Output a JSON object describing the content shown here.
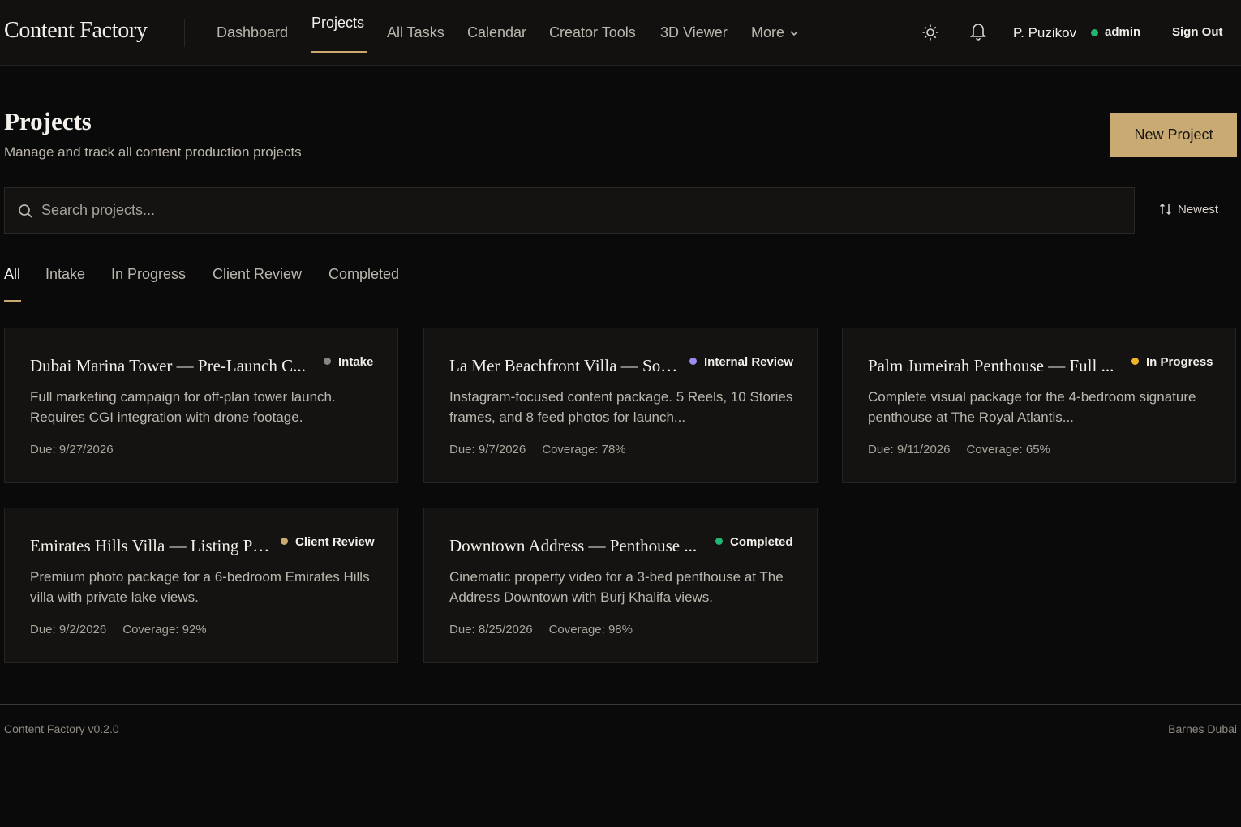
{
  "header": {
    "brand": "Content Factory",
    "nav": [
      {
        "label": "Dashboard"
      },
      {
        "label": "Projects"
      },
      {
        "label": "All Tasks"
      },
      {
        "label": "Calendar"
      },
      {
        "label": "Creator Tools"
      },
      {
        "label": "3D Viewer"
      },
      {
        "label": "More"
      }
    ],
    "active_nav": "Projects",
    "theme_icon": "sun-icon",
    "notification_icon": "bell-icon",
    "user": {
      "name": "P. Puzikov",
      "role": "admin",
      "status_color": "#22b573"
    },
    "sign_out_label": "Sign Out"
  },
  "page": {
    "title": "Projects",
    "subtitle": "Manage and track all content production projects",
    "new_button_label": "New Project",
    "accent_color": "#c8aa72"
  },
  "search": {
    "placeholder": "Search projects...",
    "value": ""
  },
  "sort": {
    "label": "Newest"
  },
  "tabs": [
    {
      "label": "All"
    },
    {
      "label": "Intake"
    },
    {
      "label": "In Progress"
    },
    {
      "label": "Client Review"
    },
    {
      "label": "Completed"
    }
  ],
  "active_tab": "All",
  "projects": [
    {
      "title": "Dubai Marina Tower — Pre-Launch C...",
      "status": "Intake",
      "status_color": "#8a8580",
      "description": "Full marketing campaign for off-plan tower launch. Requires CGI integration with drone footage.",
      "due": "Due: 9/27/2026",
      "coverage": ""
    },
    {
      "title": "La Mer Beachfront Villa — Soc...",
      "status": "Internal Review",
      "status_color": "#9b8cf0",
      "description": "Instagram-focused content package. 5 Reels, 10 Stories frames, and 8 feed photos for launch...",
      "due": "Due: 9/7/2026",
      "coverage": "Coverage: 78%"
    },
    {
      "title": "Palm Jumeirah Penthouse — Full ...",
      "status": "In Progress",
      "status_color": "#f0b429",
      "description": "Complete visual package for the 4-bedroom signature penthouse at The Royal Atlantis...",
      "due": "Due: 9/11/2026",
      "coverage": "Coverage: 65%"
    },
    {
      "title": "Emirates Hills Villa — Listing Ph...",
      "status": "Client Review",
      "status_color": "#c8aa72",
      "description": "Premium photo package for a 6-bedroom Emirates Hills villa with private lake views.",
      "due": "Due: 9/2/2026",
      "coverage": "Coverage: 92%"
    },
    {
      "title": "Downtown Address — Penthouse ...",
      "status": "Completed",
      "status_color": "#22b573",
      "description": "Cinematic property video for a 3-bed penthouse at The Address Downtown with Burj Khalifa views.",
      "due": "Due: 8/25/2026",
      "coverage": "Coverage: 98%"
    }
  ],
  "footer": {
    "version": "Content Factory v0.2.0",
    "company": "Barnes Dubai"
  }
}
